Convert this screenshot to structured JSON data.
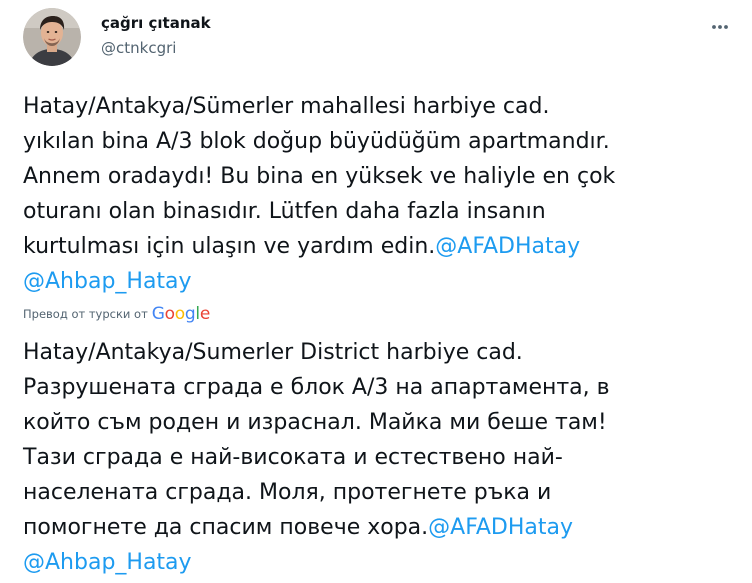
{
  "user": {
    "display_name": "çağrı çıtanak",
    "handle": "@ctnkcgri",
    "avatar_icon": "profile-photo"
  },
  "more_icon": "more-horizontal-icon",
  "tweet": {
    "lines": [
      {
        "text": "Hatay/Antakya/Sümerler mahallesi harbiye cad."
      },
      {
        "text": "yıkılan bina A/3 blok doğup büyüdüğüm apartmandır."
      },
      {
        "text": "Annem oradaydı! Bu bina en yüksek ve haliyle en çok"
      },
      {
        "text": "oturanı olan binasıdır. Lütfen daha fazla insanın"
      },
      {
        "text": "kurtulması için ulaşın ve yardım edin.",
        "mention": "@AFADHatay"
      },
      {
        "text": "",
        "mention": "@Ahbap_Hatay"
      }
    ]
  },
  "translation": {
    "label": "Превод от турски от",
    "provider": "Google",
    "provider_colors": [
      "#4285F4",
      "#EA4335",
      "#FBBC05",
      "#4285F4",
      "#34A853",
      "#EA4335"
    ],
    "lines": [
      {
        "text": "Hatay/Antakya/Sumerler District harbiye cad."
      },
      {
        "text": "Разрушената сграда е блок А/3 на апартамента, в"
      },
      {
        "text": "който съм роден и израснал. Майка ми беше там!"
      },
      {
        "text": "Тази сграда е най-високата и естествено най-"
      },
      {
        "text": "населената сграда. Моля, протегнете ръка и"
      },
      {
        "text": "помогнете да спасим повече хора.",
        "mention": "@AFADHatay"
      },
      {
        "text": "",
        "mention": "@Ahbap_Hatay"
      }
    ]
  },
  "colors": {
    "text_primary": "#0f1419",
    "text_secondary": "#536471",
    "link": "#1d9bf0"
  }
}
